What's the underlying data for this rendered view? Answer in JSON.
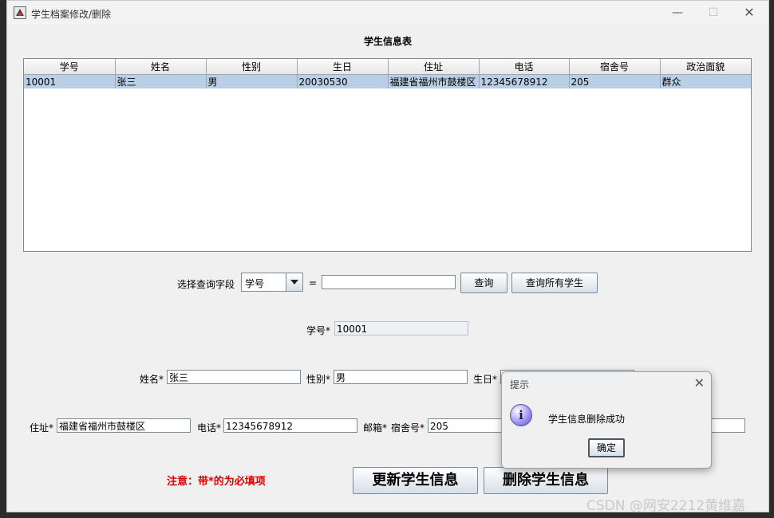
{
  "window": {
    "title": "学生档案修改/删除",
    "controls": {
      "minimize": "—",
      "maximize": "☐",
      "close": "✕"
    }
  },
  "table": {
    "heading": "学生信息表",
    "columns": [
      "学号",
      "姓名",
      "性别",
      "生日",
      "住址",
      "电话",
      "宿舍号",
      "政治面貌"
    ],
    "rows": [
      [
        "10001",
        "张三",
        "男",
        "20030530",
        "福建省福州市鼓楼区",
        "12345678912",
        "205",
        "群众"
      ]
    ]
  },
  "query": {
    "field_label": "选择查询字段",
    "field_value": "学号",
    "equals": "=",
    "input_value": "",
    "query_button": "查询",
    "query_all_button": "查询所有学生"
  },
  "form": {
    "id_label": "学号*",
    "id_value": "10001",
    "name_label": "姓名*",
    "name_value": "张三",
    "gender_label": "性别*",
    "gender_value": "男",
    "birthday_label": "生日*",
    "birthday_value": "",
    "address_label": "住址*",
    "address_value": "福建省福州市鼓楼区",
    "phone_label": "电话*",
    "phone_value": "12345678912",
    "email_label": "邮箱*",
    "dorm_label": "宿舍号*",
    "dorm_value": "205",
    "politics_value": ""
  },
  "note": "注意：带*的为必填项",
  "buttons": {
    "update": "更新学生信息",
    "delete": "删除学生信息"
  },
  "dialog": {
    "title": "提示",
    "message": "学生信息删除成功",
    "ok": "确定",
    "close": "✕",
    "icon": "i"
  },
  "watermark": "CSDN @网安2212黄维嘉"
}
